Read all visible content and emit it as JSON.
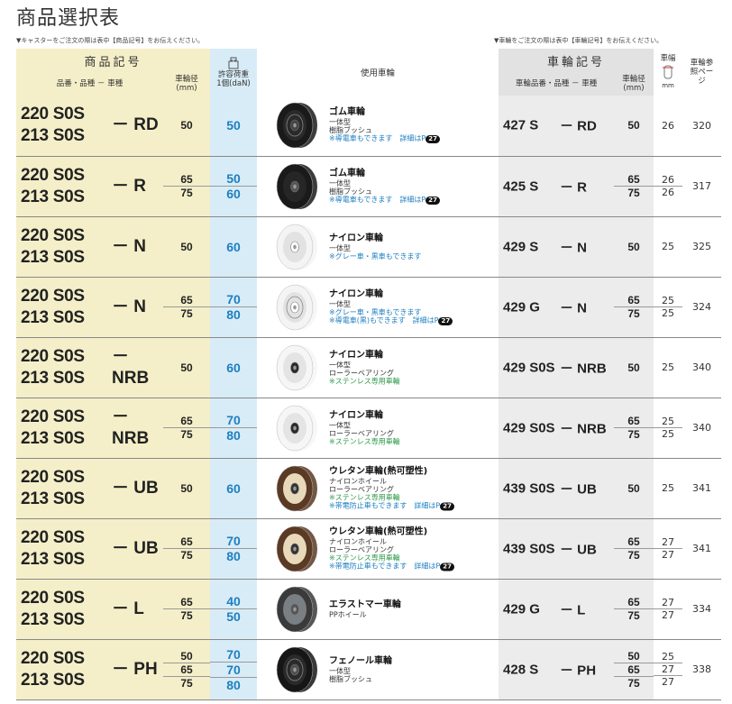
{
  "title": "商品選択表",
  "note_left": "▼キャスターをご注文の際は表中【商品記号】をお伝えください。",
  "note_right": "▼車輪をご注文の際は表中【車輪記号】をお伝えください。",
  "header": {
    "product_code": "商品記号",
    "product_sub": "品番・品種 － 車種",
    "wheel_dia": "車輪径",
    "wheel_dia_unit": "(mm)",
    "load": "許容荷重",
    "load_unit": "1個(daN)",
    "wheel_used": "使用車輪",
    "wheel_code": "車輪記号",
    "wheel_code_sub": "車輪品番・品種 － 車種",
    "wheel_dia2": "車輪径",
    "wheel_dia2_unit": "(mm)",
    "width": "車幅",
    "width_unit": "mm",
    "ref": "車輪参照ページ"
  },
  "rows": [
    {
      "prefix1": "220 S0S",
      "prefix2": "213 S0S",
      "suffix": "－ RD",
      "dia": [
        "50"
      ],
      "load": [
        "50"
      ],
      "wheel_name": "ゴム車輪",
      "desc": [
        "一体型",
        "樹脂ブッシュ"
      ],
      "green": [],
      "blue": [
        "※導電車もできます　詳細はP"
      ],
      "badge": "27",
      "wheel_type": "rubber-rd",
      "wheel_prefix": "427 S",
      "wheel_suffix": "－ RD",
      "wdia": [
        "50"
      ],
      "width": [
        "26"
      ],
      "ref": "320"
    },
    {
      "prefix1": "220 S0S",
      "prefix2": "213 S0S",
      "suffix": "－ R",
      "dia": [
        "65",
        "75"
      ],
      "load": [
        "50",
        "60"
      ],
      "wheel_name": "ゴム車輪",
      "desc": [
        "一体型",
        "樹脂ブッシュ"
      ],
      "green": [],
      "blue": [
        "※導電車もできます　詳細はP"
      ],
      "badge": "27",
      "wheel_type": "rubber",
      "wheel_prefix": "425 S",
      "wheel_suffix": "－ R",
      "wdia": [
        "65",
        "75"
      ],
      "width": [
        "26",
        "26"
      ],
      "ref": "317"
    },
    {
      "prefix1": "220 S0S",
      "prefix2": "213 S0S",
      "suffix": "－ N",
      "dia": [
        "50"
      ],
      "load": [
        "60"
      ],
      "wheel_name": "ナイロン車輪",
      "desc": [
        "一体型"
      ],
      "green": [],
      "blue": [
        "※グレー車・黒車もできます"
      ],
      "badge": "",
      "wheel_type": "nylon",
      "wheel_prefix": "429 S",
      "wheel_suffix": "－ N",
      "wdia": [
        "50"
      ],
      "width": [
        "25"
      ],
      "ref": "325"
    },
    {
      "prefix1": "220 S0S",
      "prefix2": "213 S0S",
      "suffix": "－ N",
      "dia": [
        "65",
        "75"
      ],
      "load": [
        "70",
        "80"
      ],
      "wheel_name": "ナイロン車輪",
      "desc": [
        "一体型"
      ],
      "green": [],
      "blue": [
        "※グレー車・黒車もできます",
        "※導電車(黒)もできます　詳細はP"
      ],
      "badge": "27",
      "wheel_type": "nylon2",
      "wheel_prefix": "429 G",
      "wheel_suffix": "－ N",
      "wdia": [
        "65",
        "75"
      ],
      "width": [
        "25",
        "25"
      ],
      "ref": "324"
    },
    {
      "prefix1": "220 S0S",
      "prefix2": "213 S0S",
      "suffix": "－ NRB",
      "dia": [
        "50"
      ],
      "load": [
        "60"
      ],
      "wheel_name": "ナイロン車輪",
      "desc": [
        "一体型",
        "ローラーベアリング"
      ],
      "green": [
        "※ステンレス専用車輪"
      ],
      "blue": [],
      "badge": "",
      "wheel_type": "nylon-rb",
      "wheel_prefix": "429 S0S",
      "wheel_suffix": "－ NRB",
      "wdia": [
        "50"
      ],
      "width": [
        "25"
      ],
      "ref": "340"
    },
    {
      "prefix1": "220 S0S",
      "prefix2": "213 S0S",
      "suffix": "－ NRB",
      "dia": [
        "65",
        "75"
      ],
      "load": [
        "70",
        "80"
      ],
      "wheel_name": "ナイロン車輪",
      "desc": [
        "一体型",
        "ローラーベアリング"
      ],
      "green": [
        "※ステンレス専用車輪"
      ],
      "blue": [],
      "badge": "",
      "wheel_type": "nylon-rb",
      "wheel_prefix": "429 S0S",
      "wheel_suffix": "－ NRB",
      "wdia": [
        "65",
        "75"
      ],
      "width": [
        "25",
        "25"
      ],
      "ref": "340"
    },
    {
      "prefix1": "220 S0S",
      "prefix2": "213 S0S",
      "suffix": "－ UB",
      "dia": [
        "50"
      ],
      "load": [
        "60"
      ],
      "wheel_name": "ウレタン車輪(熱可塑性)",
      "desc": [
        "ナイロンホイール",
        "ローラーベアリング"
      ],
      "green": [
        "※ステンレス専用車輪"
      ],
      "blue": [
        "※帯電防止車もできます　詳細はP"
      ],
      "badge": "27",
      "wheel_type": "urethane",
      "wheel_prefix": "439 S0S",
      "wheel_suffix": "－ UB",
      "wdia": [
        "50"
      ],
      "width": [
        "25"
      ],
      "ref": "341"
    },
    {
      "prefix1": "220 S0S",
      "prefix2": "213 S0S",
      "suffix": "－ UB",
      "dia": [
        "65",
        "75"
      ],
      "load": [
        "70",
        "80"
      ],
      "wheel_name": "ウレタン車輪(熱可塑性)",
      "desc": [
        "ナイロンホイール",
        "ローラーベアリング"
      ],
      "green": [
        "※ステンレス専用車輪"
      ],
      "blue": [
        "※帯電防止車もできます　詳細はP"
      ],
      "badge": "27",
      "wheel_type": "urethane",
      "wheel_prefix": "439 S0S",
      "wheel_suffix": "－ UB",
      "wdia": [
        "65",
        "75"
      ],
      "width": [
        "27",
        "27"
      ],
      "ref": "341"
    },
    {
      "prefix1": "220 S0S",
      "prefix2": "213 S0S",
      "suffix": "－ L",
      "dia": [
        "65",
        "75"
      ],
      "load": [
        "40",
        "50"
      ],
      "wheel_name": "エラストマー車輪",
      "desc": [
        "PPホイール"
      ],
      "green": [],
      "blue": [],
      "badge": "",
      "wheel_type": "elastomer",
      "wheel_prefix": "429 G",
      "wheel_suffix": "－ L",
      "wdia": [
        "65",
        "75"
      ],
      "width": [
        "27",
        "27"
      ],
      "ref": "334"
    },
    {
      "prefix1": "220 S0S",
      "prefix2": "213 S0S",
      "suffix": "－ PH",
      "dia": [
        "50",
        "65",
        "75"
      ],
      "load": [
        "70",
        "70",
        "80"
      ],
      "wheel_name": "フェノール車輪",
      "desc": [
        "一体型",
        "樹脂ブッシュ"
      ],
      "green": [],
      "blue": [],
      "badge": "",
      "wheel_type": "phenol",
      "wheel_prefix": "428 S",
      "wheel_suffix": "－ PH",
      "wdia": [
        "50",
        "65",
        "75"
      ],
      "width": [
        "25",
        "27",
        "27"
      ],
      "ref": "338"
    }
  ]
}
